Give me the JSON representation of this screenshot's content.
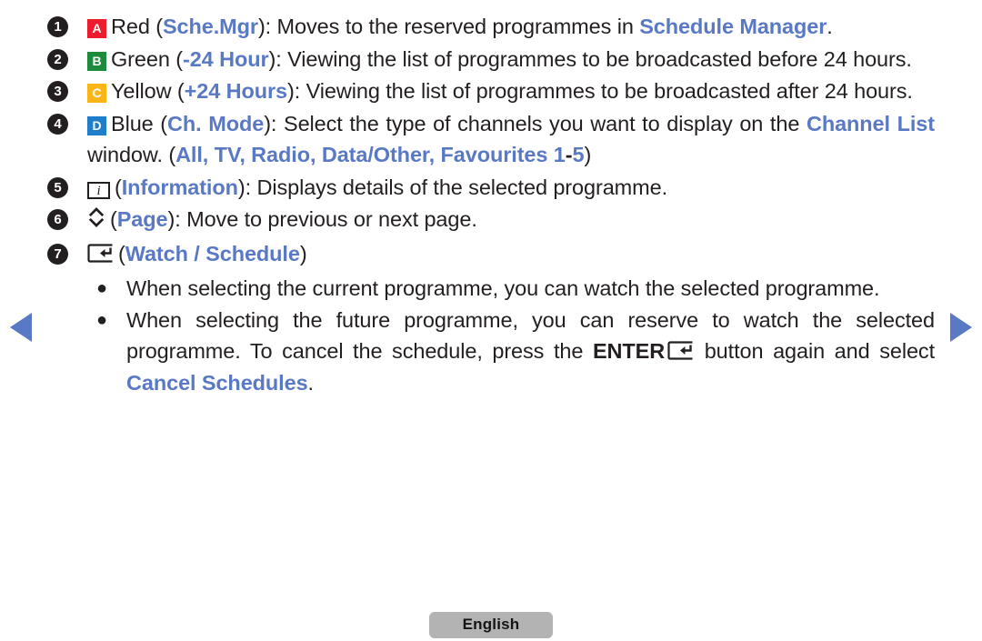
{
  "nav": {
    "prev_label": "◀",
    "next_label": "▶",
    "arrow_color": "#5a79c4"
  },
  "colors": {
    "accent_blue": "#5a79c4",
    "key_red": "#ed1b2e",
    "key_green": "#1e8b3c",
    "key_yellow": "#fbb515",
    "key_blue": "#1f7ecb",
    "text": "#231f20",
    "chip_bg": "#b3b3b3"
  },
  "items": [
    {
      "num": "1",
      "badge": "A",
      "badge_color": "#ed1b2e",
      "colour_name": "Red",
      "open_paren": " (",
      "key_name": "Sche.Mgr",
      "close_paren": "): ",
      "desc_part1": "Moves to the reserved programmes in ",
      "highlight": "Schedule Manager",
      "desc_part2": "."
    },
    {
      "num": "2",
      "badge": "B",
      "badge_color": "#1e8b3c",
      "colour_name": "Green",
      "open_paren": " (",
      "key_name": "-24 Hour",
      "close_paren": "): ",
      "desc_part1": "Viewing the list of programmes to be broadcasted before 24 hours."
    },
    {
      "num": "3",
      "badge": "C",
      "badge_color": "#fbb515",
      "colour_name": "Yellow",
      "open_paren": " (",
      "key_name": "+24 Hours",
      "close_paren": "): ",
      "desc_part1": "Viewing the list of programmes to be broadcasted after 24 hours."
    },
    {
      "num": "4",
      "badge": "D",
      "badge_color": "#1f7ecb",
      "colour_name": "Blue",
      "open_paren": " (",
      "key_name": "Ch. Mode",
      "close_paren": "): ",
      "desc_part1": "Select the type of channels you want to display on the ",
      "highlight": "Channel List",
      "desc_part2": " window. (",
      "options": "All, TV, Radio, Data/Other, Favourites 1",
      "options_dash": "-",
      "options_end": "5",
      "desc_part3": ")"
    },
    {
      "num": "5",
      "icon": "info-icon",
      "open_paren": "(",
      "key_name": "Information",
      "close_paren": "): ",
      "desc_part1": "Displays details of the selected programme."
    },
    {
      "num": "6",
      "icon": "page-up-down-icon",
      "open_paren": "(",
      "key_name": "Page",
      "close_paren": "): ",
      "desc_part1": "Move to previous or next page."
    },
    {
      "num": "7",
      "icon": "enter-icon",
      "open_paren": "(",
      "key_name": "Watch / Schedule",
      "close_paren": ")"
    }
  ],
  "bullets": [
    {
      "dot": "●",
      "text": "When selecting the current programme, you can watch the selected programme."
    },
    {
      "dot": "●",
      "pre": "When selecting the future programme, you can reserve to watch the selected programme. To cancel the schedule, press the ",
      "enter_label": "ENTER",
      "mid": " button again and select ",
      "highlight": "Cancel Schedules",
      "post": "."
    }
  ],
  "footer": {
    "language": "English"
  }
}
